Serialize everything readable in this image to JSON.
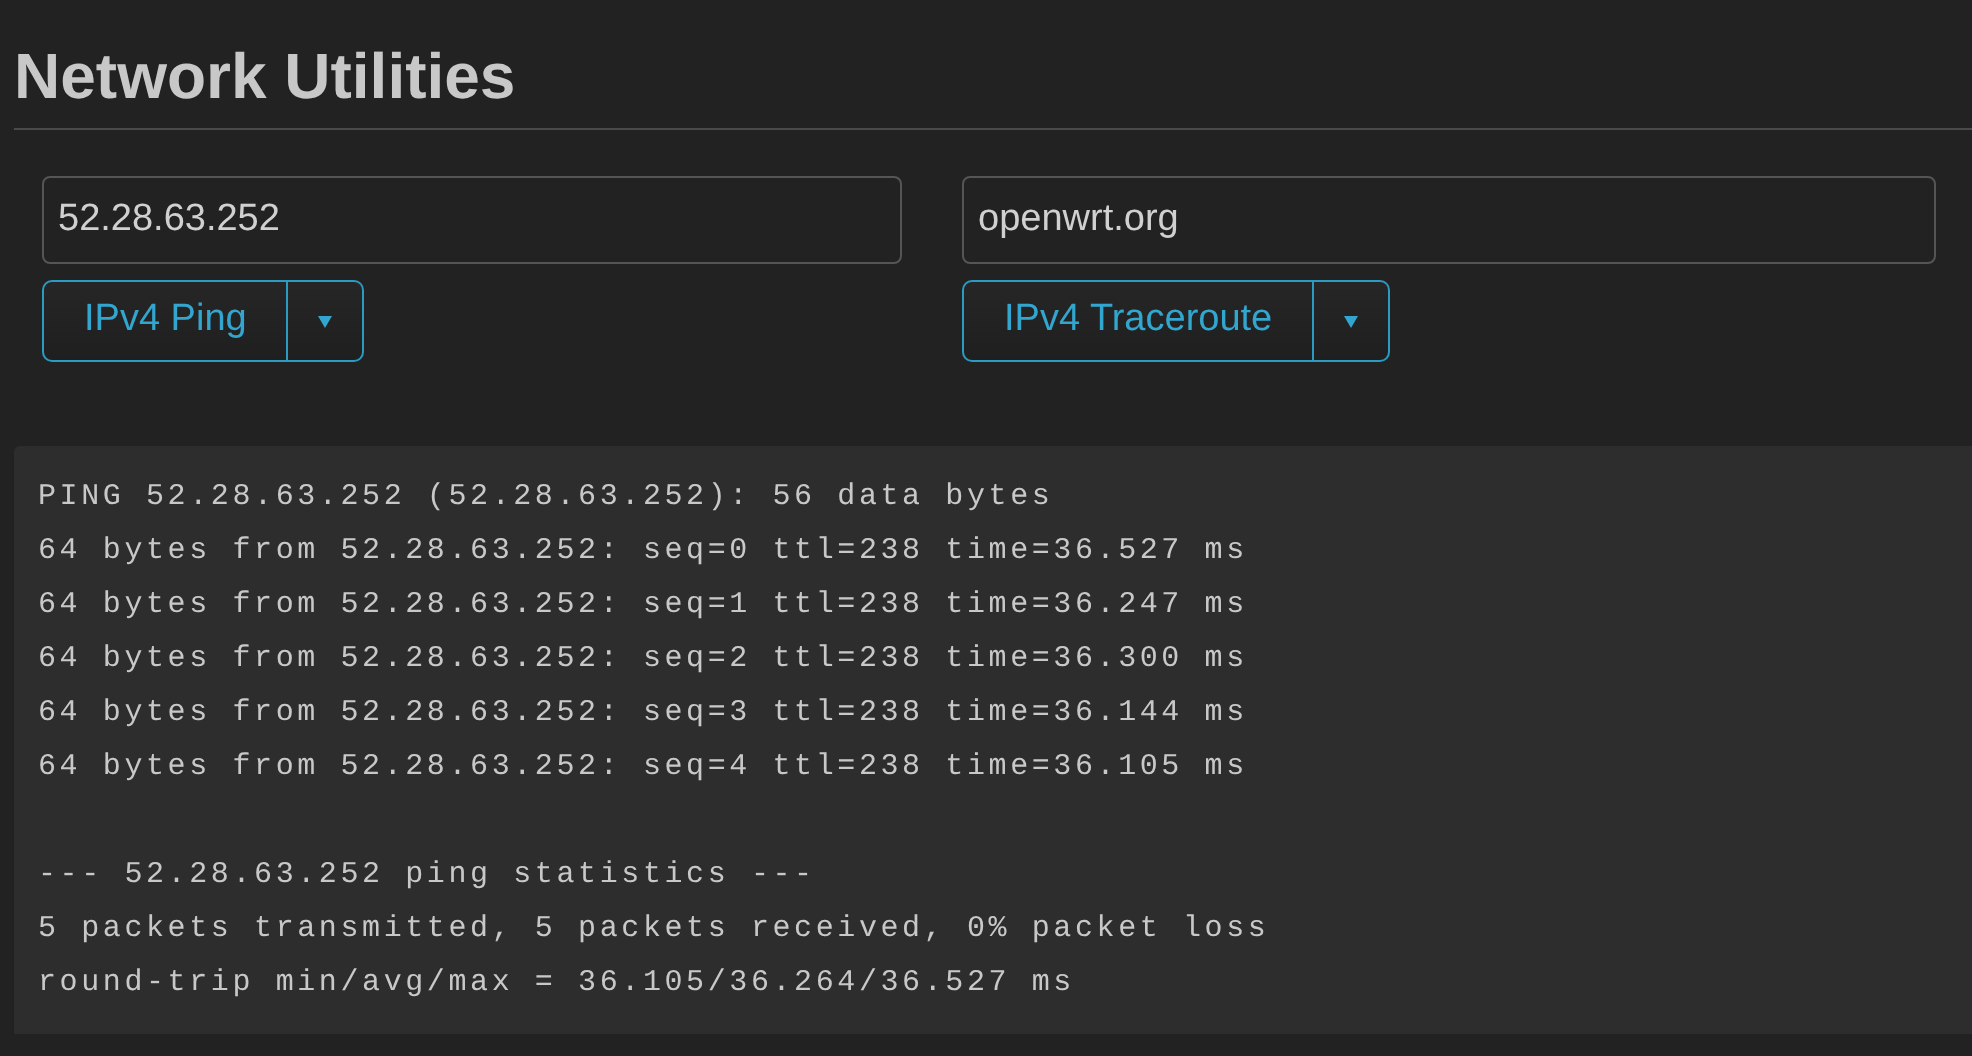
{
  "title": "Network Utilities",
  "tools": [
    {
      "field_value": "52.28.63.252",
      "action": "IPv4 Ping"
    },
    {
      "field_value": "openwrt.org",
      "action": "IPv4 Traceroute"
    }
  ],
  "output": {
    "blocks": [
      [
        "PING 52.28.63.252 (52.28.63.252): 56 data bytes",
        "64 bytes from 52.28.63.252: seq=0 ttl=238 time=36.527 ms",
        "64 bytes from 52.28.63.252: seq=1 ttl=238 time=36.247 ms",
        "64 bytes from 52.28.63.252: seq=2 ttl=238 time=36.300 ms",
        "64 bytes from 52.28.63.252: seq=3 ttl=238 time=36.144 ms",
        "64 bytes from 52.28.63.252: seq=4 ttl=238 time=36.105 ms"
      ],
      [
        "--- 52.28.63.252 ping statistics ---",
        "5 packets transmitted, 5 packets received, 0% packet loss",
        "round-trip min/avg/max = 36.105/36.264/36.527 ms"
      ]
    ]
  }
}
